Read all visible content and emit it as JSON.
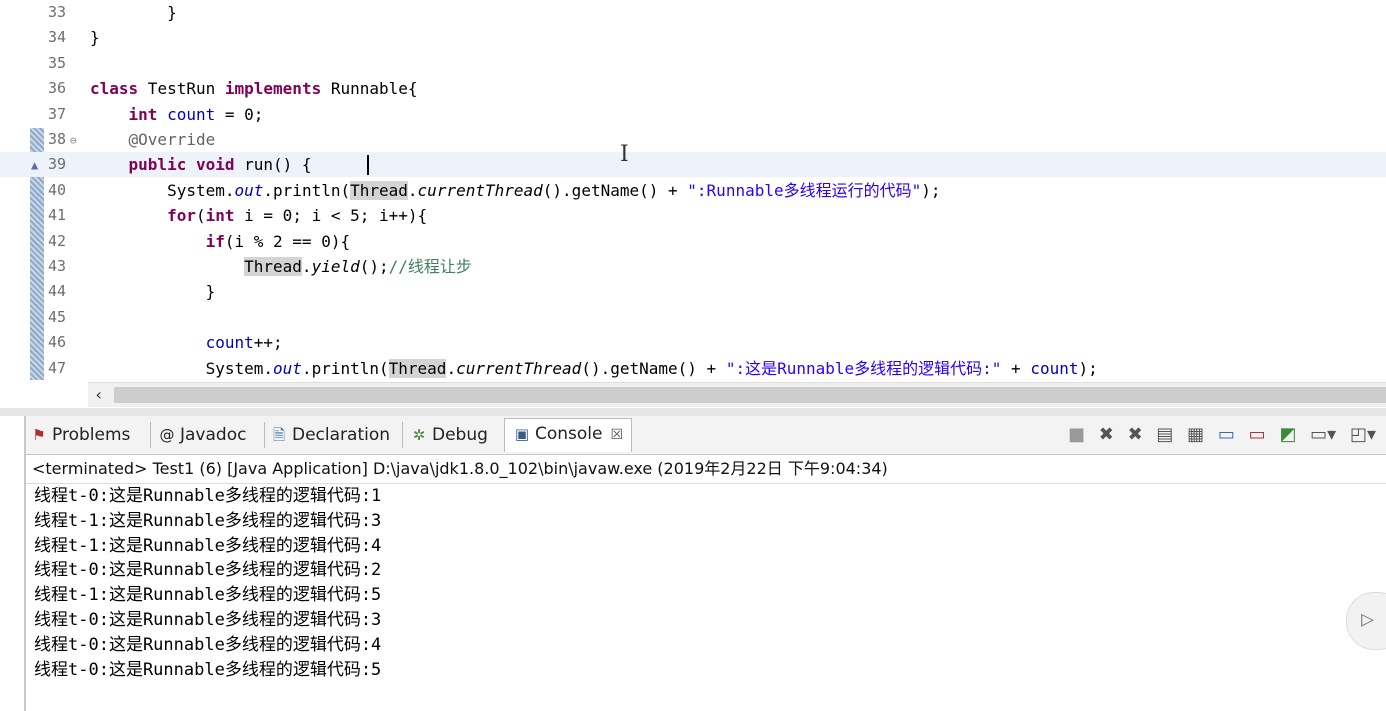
{
  "editor": {
    "lines": [
      {
        "num": "33",
        "indent": "        ",
        "parts": [
          [
            "",
            "}"
          ]
        ]
      },
      {
        "num": "34",
        "indent": "",
        "parts": [
          [
            "",
            "}"
          ]
        ]
      },
      {
        "num": "35",
        "indent": "",
        "parts": []
      },
      {
        "num": "36",
        "indent": "",
        "parts": [
          [
            "kw",
            "class"
          ],
          [
            "",
            " TestRun "
          ],
          [
            "kw",
            "implements"
          ],
          [
            "",
            " Runnable{"
          ]
        ]
      },
      {
        "num": "37",
        "indent": "    ",
        "parts": [
          [
            "kw",
            "int"
          ],
          [
            "",
            " "
          ],
          [
            "fld",
            "count"
          ],
          [
            "",
            " = 0;"
          ]
        ]
      },
      {
        "num": "38",
        "indent": "    ",
        "parts": [
          [
            "ann",
            "@Override"
          ]
        ]
      },
      {
        "num": "39",
        "indent": "    ",
        "parts": [
          [
            "kw",
            "public"
          ],
          [
            "",
            " "
          ],
          [
            "kw",
            "void"
          ],
          [
            "",
            " run() {"
          ]
        ]
      },
      {
        "num": "40",
        "indent": "        ",
        "parts": [
          [
            "",
            "System."
          ],
          [
            "fld it",
            "out"
          ],
          [
            "",
            ".println("
          ],
          [
            "hl",
            "Thread"
          ],
          [
            "",
            "."
          ],
          [
            "it",
            "currentThread"
          ],
          [
            "",
            "().getName() + "
          ],
          [
            "str",
            "\":Runnable多线程运行的代码\""
          ],
          [
            "",
            ");"
          ]
        ]
      },
      {
        "num": "41",
        "indent": "        ",
        "parts": [
          [
            "kw",
            "for"
          ],
          [
            "",
            "("
          ],
          [
            "kw",
            "int"
          ],
          [
            "",
            " i = 0; i < 5; i++){"
          ]
        ]
      },
      {
        "num": "42",
        "indent": "            ",
        "parts": [
          [
            "kw",
            "if"
          ],
          [
            "",
            "(i % 2 == 0){"
          ]
        ]
      },
      {
        "num": "43",
        "indent": "                ",
        "parts": [
          [
            "hl",
            "Thread"
          ],
          [
            "",
            "."
          ],
          [
            "it",
            "yield"
          ],
          [
            "",
            "();"
          ],
          [
            "cm",
            "//线程让步"
          ]
        ]
      },
      {
        "num": "44",
        "indent": "            ",
        "parts": [
          [
            "",
            "}"
          ]
        ]
      },
      {
        "num": "45",
        "indent": "",
        "parts": []
      },
      {
        "num": "46",
        "indent": "            ",
        "parts": [
          [
            "fld",
            "count"
          ],
          [
            "",
            "++;"
          ]
        ]
      },
      {
        "num": "47",
        "indent": "            ",
        "parts": [
          [
            "",
            "System."
          ],
          [
            "fld it",
            "out"
          ],
          [
            "",
            ".println("
          ],
          [
            "hl",
            "Thread"
          ],
          [
            "",
            "."
          ],
          [
            "it",
            "currentThread"
          ],
          [
            "",
            "().getName() + "
          ],
          [
            "str",
            "\":这是Runnable多线程的逻辑代码:\""
          ],
          [
            "",
            " + "
          ],
          [
            "fld",
            "count"
          ],
          [
            "",
            ");"
          ]
        ]
      }
    ]
  },
  "tabs": {
    "problems": "Problems",
    "javadoc": "Javadoc",
    "declaration": "Declaration",
    "debug": "Debug",
    "console": "Console"
  },
  "status": "<terminated> Test1 (6) [Java Application] D:\\java\\jdk1.8.0_102\\bin\\javaw.exe (2019年2月22日 下午9:04:34)",
  "console_lines": [
    "线程t-0:这是Runnable多线程的逻辑代码:1",
    "线程t-1:这是Runnable多线程的逻辑代码:3",
    "线程t-1:这是Runnable多线程的逻辑代码:4",
    "线程t-0:这是Runnable多线程的逻辑代码:2",
    "线程t-1:这是Runnable多线程的逻辑代码:5",
    "线程t-0:这是Runnable多线程的逻辑代码:3",
    "线程t-0:这是Runnable多线程的逻辑代码:4",
    "线程t-0:这是Runnable多线程的逻辑代码:5"
  ]
}
